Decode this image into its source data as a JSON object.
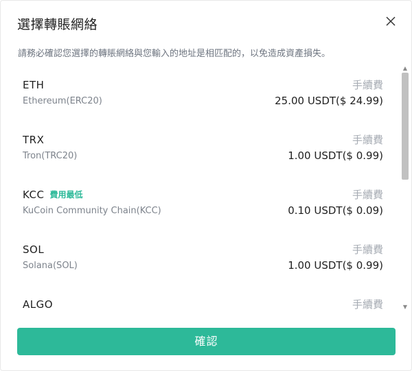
{
  "dialog": {
    "title": "選擇轉賬網絡",
    "notice": "請務必確認您選擇的轉賬網絡與您輸入的地址是相匹配的，以免造成資產損失。",
    "confirm_label": "確認"
  },
  "networks": [
    {
      "symbol": "ETH",
      "name": "Ethereum(ERC20)",
      "fee_label": "手續費",
      "fee": "25.00 USDT($ 24.99)",
      "badge": ""
    },
    {
      "symbol": "TRX",
      "name": "Tron(TRC20)",
      "fee_label": "手續費",
      "fee": "1.00 USDT($ 0.99)",
      "badge": ""
    },
    {
      "symbol": "KCC",
      "name": "KuCoin Community Chain(KCC)",
      "fee_label": "手續費",
      "fee": "0.10 USDT($ 0.09)",
      "badge": "費用最低"
    },
    {
      "symbol": "SOL",
      "name": "Solana(SOL)",
      "fee_label": "手續費",
      "fee": "1.00 USDT($ 0.99)",
      "badge": ""
    },
    {
      "symbol": "ALGO",
      "name": "",
      "fee_label": "手續費",
      "fee": "",
      "badge": ""
    }
  ],
  "icons": {
    "close": "close-icon",
    "scroll_up": "scroll-up-arrow-icon",
    "scroll_down": "scroll-down-arrow-icon"
  },
  "colors": {
    "accent": "#2db999",
    "muted": "#a6abb3"
  }
}
